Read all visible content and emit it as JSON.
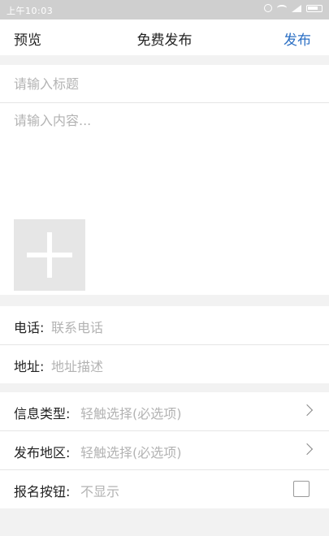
{
  "status_bar": {
    "time": "上午10:03"
  },
  "nav": {
    "left": "预览",
    "title": "免费发布",
    "right": "发布"
  },
  "form": {
    "title_placeholder": "请输入标题",
    "content_placeholder": "请输入内容...",
    "add_photo_icon": "plus-icon"
  },
  "contact": {
    "phone": {
      "label": "电话:",
      "placeholder": "联系电话"
    },
    "address": {
      "label": "地址:",
      "placeholder": "地址描述"
    }
  },
  "options": {
    "info_type": {
      "label": "信息类型:",
      "value": "轻触选择(必选项)"
    },
    "region": {
      "label": "发布地区:",
      "value": "轻触选择(必选项)"
    },
    "signup": {
      "label": "报名按钮:",
      "value": "不显示"
    }
  }
}
